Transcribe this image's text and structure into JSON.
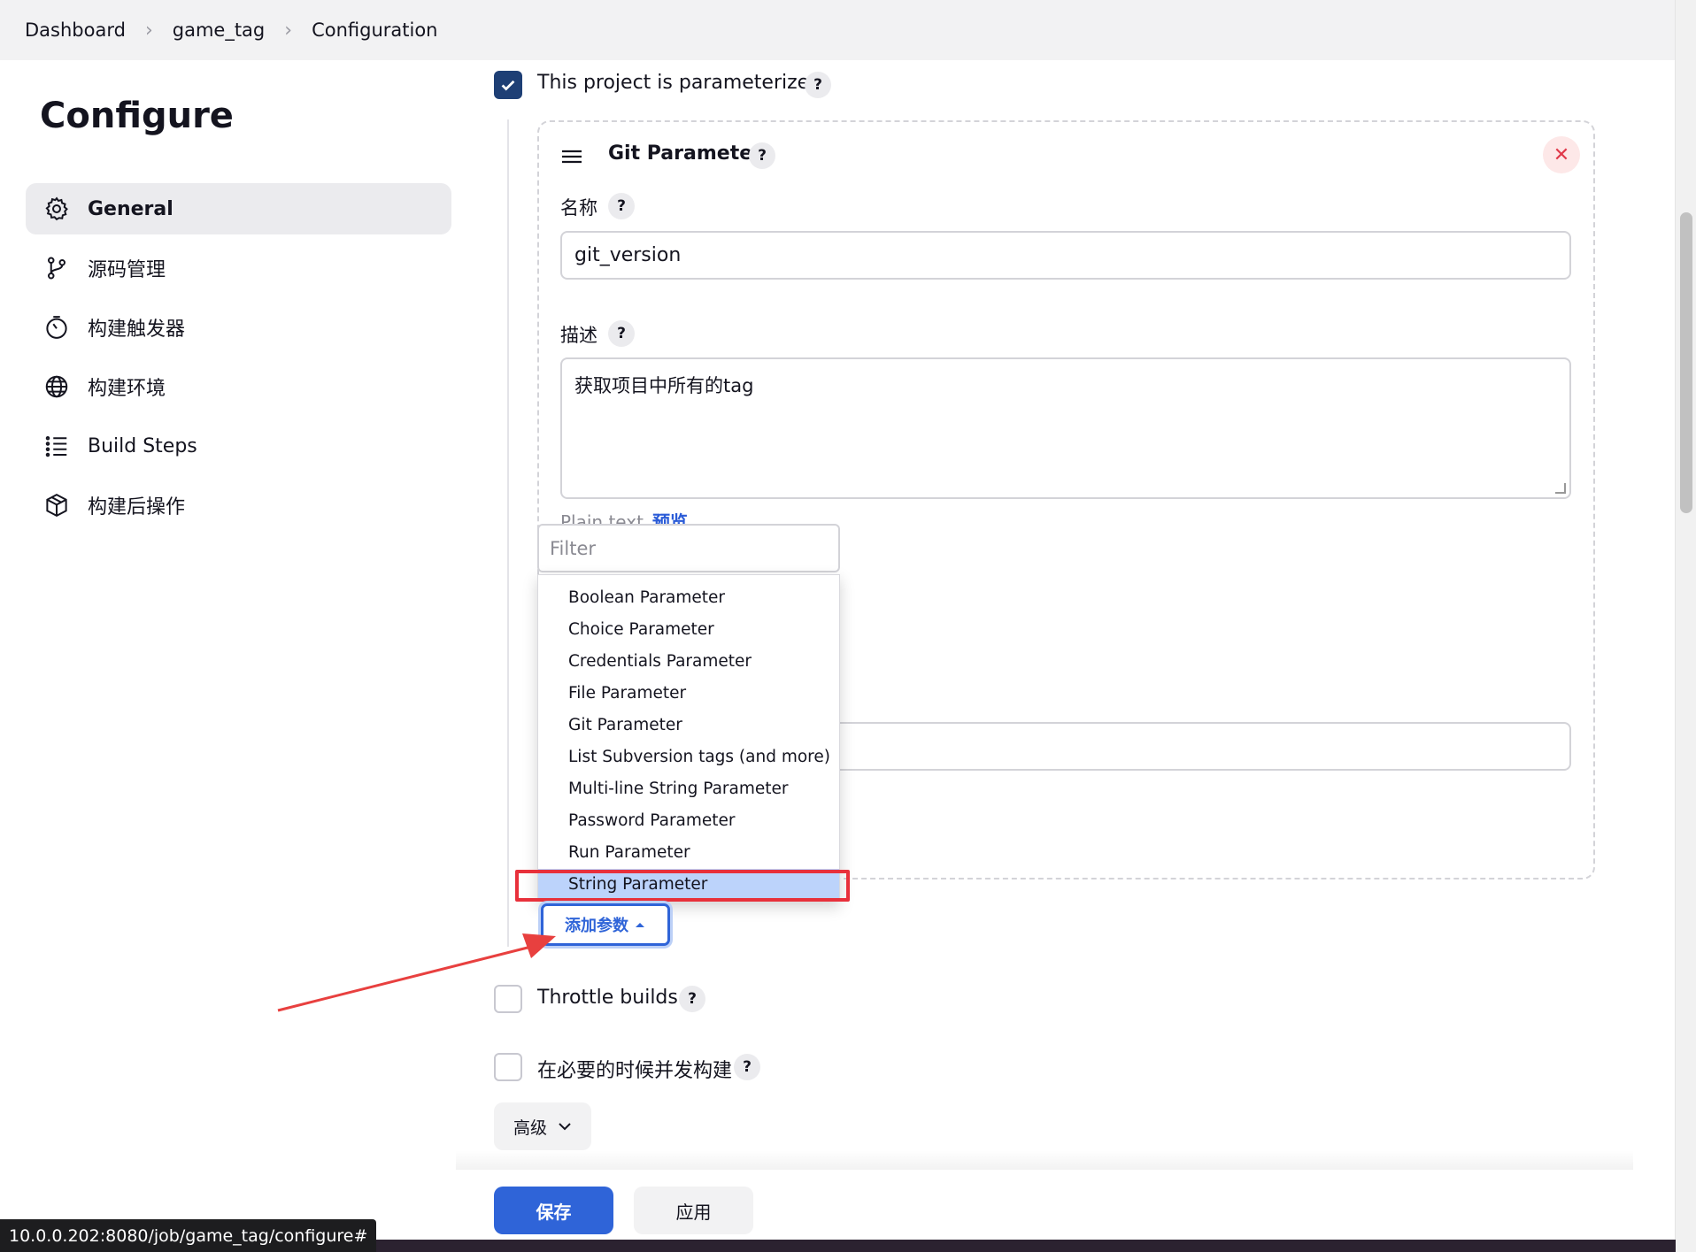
{
  "breadcrumb": {
    "items": [
      "Dashboard",
      "game_tag",
      "Configuration"
    ],
    "separator": "›"
  },
  "page_title": "Configure",
  "sidebar": {
    "items": [
      {
        "label": "General",
        "icon": "gear-icon",
        "active": true
      },
      {
        "label": "源码管理",
        "icon": "git-branch-icon"
      },
      {
        "label": "构建触发器",
        "icon": "timer-icon"
      },
      {
        "label": "构建环境",
        "icon": "globe-icon"
      },
      {
        "label": "Build Steps",
        "icon": "list-icon"
      },
      {
        "label": "构建后操作",
        "icon": "package-icon"
      }
    ]
  },
  "parameterized": {
    "label": "This project is parameterized",
    "checked": true,
    "help": "?"
  },
  "git_parameter": {
    "title": "Git Parameter",
    "help": "?",
    "close": "✕",
    "name_label": "名称",
    "name_value": "git_version",
    "desc_label": "描述",
    "desc_value": "获取项目中所有的tag",
    "plain_text": "Plain text",
    "preview": "预览"
  },
  "add_param_menu": {
    "filter_placeholder": "Filter",
    "items": [
      "Boolean Parameter",
      "Choice Parameter",
      "Credentials Parameter",
      "File Parameter",
      "Git Parameter",
      "List Subversion tags (and more)",
      "Multi-line String Parameter",
      "Password Parameter",
      "Run Parameter",
      "String Parameter"
    ],
    "selected": "String Parameter"
  },
  "add_param_button": "添加参数",
  "throttle": {
    "label": "Throttle builds",
    "checked": false,
    "help": "?"
  },
  "concurrent": {
    "label": "在必要的时候并发构建",
    "checked": false,
    "help": "?"
  },
  "advanced_button": "高级",
  "save_button": "保存",
  "apply_button": "应用",
  "status_url": "10.0.0.202:8080/job/game_tag/configure#",
  "colors": {
    "primary": "#2f64d8",
    "checkbox": "#1e3f75",
    "highlight": "#e8303b",
    "selected_item": "#bcd3fb"
  }
}
